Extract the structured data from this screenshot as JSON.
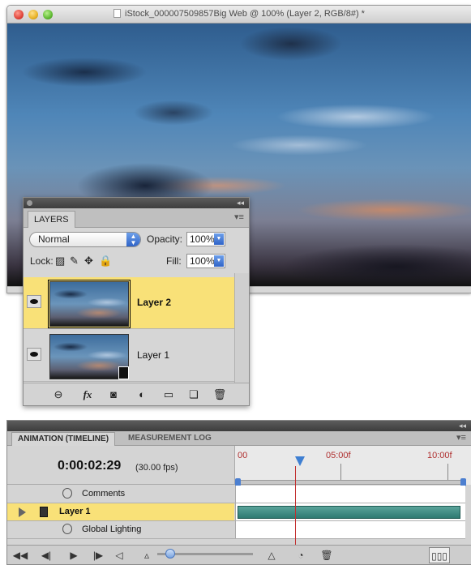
{
  "document": {
    "title": "iStock_000007509857Big Web @ 100% (Layer 2, RGB/8#) *"
  },
  "layers_panel": {
    "tab": "LAYERS",
    "blend_mode": "Normal",
    "opacity_label": "Opacity:",
    "opacity_value": "100%",
    "lock_label": "Lock:",
    "fill_label": "Fill:",
    "fill_value": "100%",
    "layers": [
      {
        "name": "Layer 2",
        "selected": true
      },
      {
        "name": "Layer 1",
        "selected": false
      }
    ],
    "bottom_icons": [
      "link-icon",
      "fx-icon",
      "mask-icon",
      "adjustment-icon",
      "folder-icon",
      "new-layer-icon",
      "trash-icon"
    ],
    "fx_label": "fx"
  },
  "animation_panel": {
    "tabs": [
      "ANIMATION (TIMELINE)",
      "MEASUREMENT LOG"
    ],
    "timecode": "0:00:02:29",
    "fps": "(30.00 fps)",
    "ruler_labels": [
      "00",
      "05:00f",
      "10:00f"
    ],
    "tracks": [
      {
        "label": "Comments"
      },
      {
        "label": "Layer 1",
        "selected": true
      },
      {
        "label": "Global Lighting"
      }
    ]
  },
  "colors": {
    "selection": "#f9e178",
    "timeline_bar": "#2e7a72",
    "playhead": "#3e7fd2",
    "ruler_text": "#b03030"
  }
}
